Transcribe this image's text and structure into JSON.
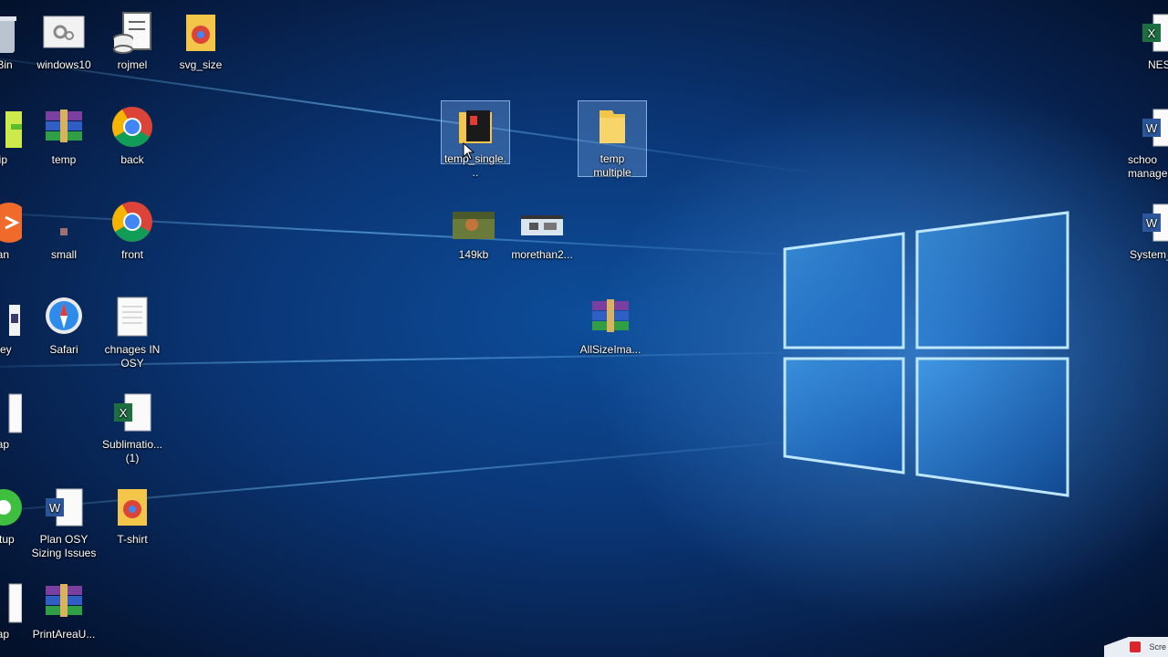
{
  "desktop": {
    "icons_col0": [
      {
        "id": "recycle",
        "label": "e Bin"
      },
      {
        "id": "dip",
        "label": "dip"
      },
      {
        "id": "nan",
        "label": "nan"
      },
      {
        "id": "key",
        "label": "_key"
      },
      {
        "id": "nap1",
        "label": "nap"
      },
      {
        "id": "setup",
        "label": "Setup"
      },
      {
        "id": "nap2",
        "label": "nap"
      }
    ],
    "icons_col1": [
      {
        "id": "windows10",
        "label": "windows10"
      },
      {
        "id": "temp",
        "label": "temp"
      },
      {
        "id": "small",
        "label": "small"
      },
      {
        "id": "safari",
        "label": "Safari"
      },
      {
        "id": "plan",
        "label": "Plan OSY Sizing Issues"
      },
      {
        "id": "printarea",
        "label": "PrintAreaU..."
      }
    ],
    "icons_col2": [
      {
        "id": "rojmel",
        "label": "rojmel"
      },
      {
        "id": "back",
        "label": "back"
      },
      {
        "id": "front",
        "label": "front"
      },
      {
        "id": "chnages",
        "label": "chnages IN OSY"
      },
      {
        "id": "sublimation",
        "label": "Sublimatio... (1)"
      },
      {
        "id": "tshirt",
        "label": "T-shirt"
      }
    ],
    "icons_col3": [
      {
        "id": "svg_size",
        "label": "svg_size"
      }
    ],
    "icons_middle": [
      {
        "id": "temp_single",
        "label": "temp_single..."
      },
      {
        "id": "temp_multiple",
        "label": "temp multiple"
      },
      {
        "id": "kb149",
        "label": "149kb"
      },
      {
        "id": "morethan",
        "label": "morethan2..."
      },
      {
        "id": "allsize",
        "label": "AllSizeIma..."
      }
    ],
    "icons_right": [
      {
        "id": "nes",
        "label": "NES"
      },
      {
        "id": "school",
        "label": "schoo manage"
      },
      {
        "id": "system",
        "label": "System_"
      }
    ],
    "corner_label": "Scre"
  },
  "colors": {
    "excel": "#1d6f42",
    "word": "#2b579a",
    "folder": "#f3c64a",
    "chrome_red": "#db4437",
    "chrome_green": "#0f9d58",
    "chrome_yellow": "#f4b400",
    "chrome_blue": "#4285f4"
  }
}
